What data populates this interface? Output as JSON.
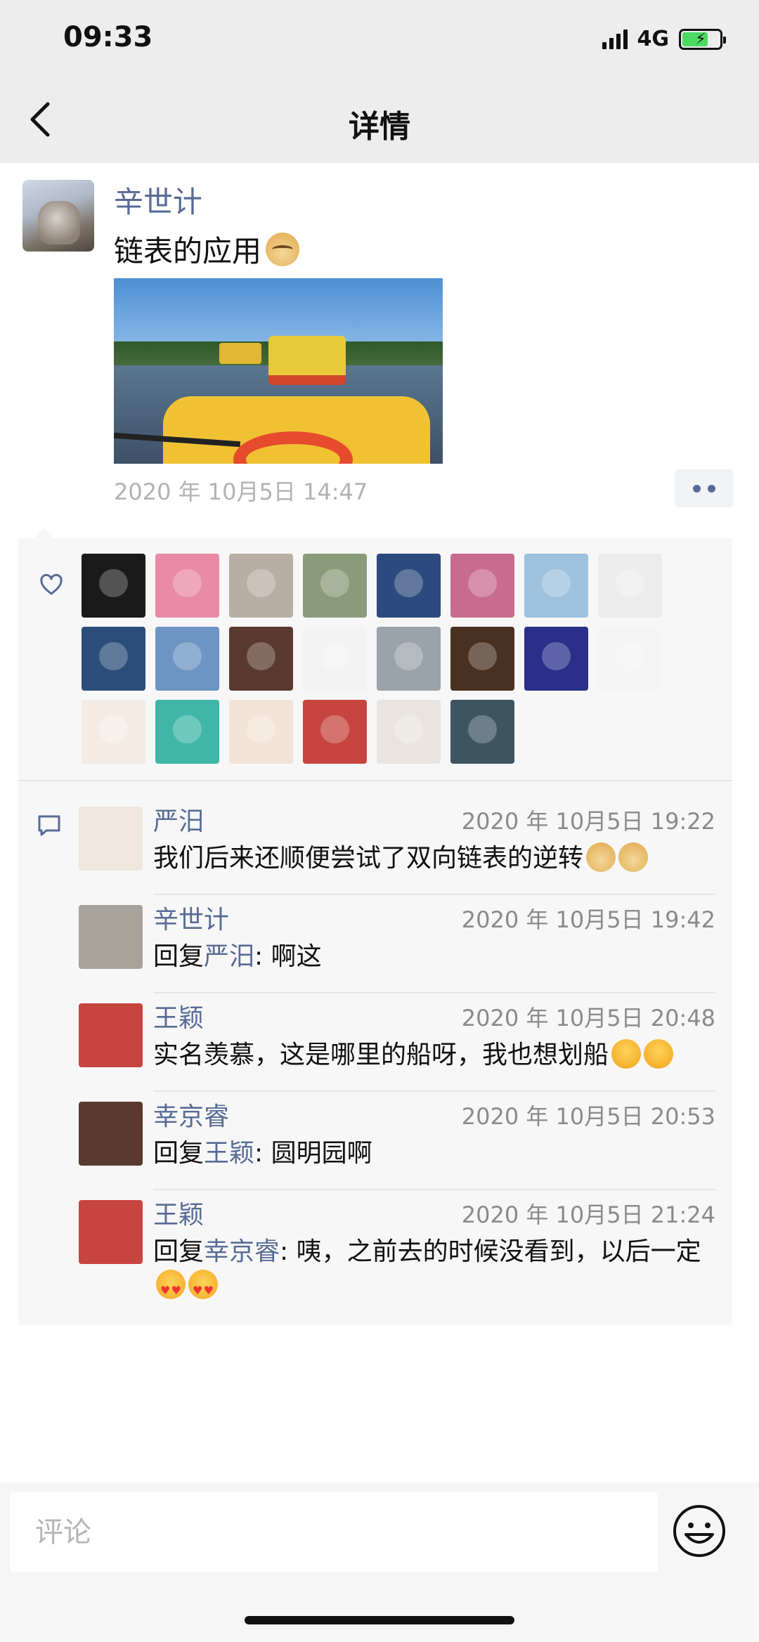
{
  "status_bar": {
    "time": "09:33",
    "network": "4G"
  },
  "nav": {
    "title": "详情"
  },
  "post": {
    "author": "辛世计",
    "text": "链表的应用",
    "timestamp": "2020 年 10月5日 14:47"
  },
  "likes": {
    "avatars": [
      {
        "name": "like-avatar-1",
        "color": "#1a1a1a"
      },
      {
        "name": "like-avatar-2",
        "color": "#e98aa6"
      },
      {
        "name": "like-avatar-3",
        "color": "#b8aea4"
      },
      {
        "name": "like-avatar-4",
        "color": "#8a9b7a"
      },
      {
        "name": "like-avatar-5",
        "color": "#2c4a7e"
      },
      {
        "name": "like-avatar-6",
        "color": "#c86b8f"
      },
      {
        "name": "like-avatar-7",
        "color": "#9ec2de"
      },
      {
        "name": "like-avatar-8",
        "color": "#ececec"
      },
      {
        "name": "like-avatar-9",
        "color": "#2b4d7a"
      },
      {
        "name": "like-avatar-10",
        "color": "#6d95c4"
      },
      {
        "name": "like-avatar-11",
        "color": "#5a3a2e"
      },
      {
        "name": "like-avatar-12",
        "color": "#f3f3f3"
      },
      {
        "name": "like-avatar-13",
        "color": "#9aa3ab"
      },
      {
        "name": "like-avatar-14",
        "color": "#4a3020"
      },
      {
        "name": "like-avatar-15",
        "color": "#2a2f8a"
      },
      {
        "name": "like-avatar-16",
        "color": "#f5f5f5"
      },
      {
        "name": "like-avatar-17",
        "color": "#f4ece4"
      },
      {
        "name": "like-avatar-18",
        "color": "#3fb6a8"
      },
      {
        "name": "like-avatar-19",
        "color": "#f1e3d6"
      },
      {
        "name": "like-avatar-20",
        "color": "#c7453f"
      },
      {
        "name": "like-avatar-21",
        "color": "#e9e4df"
      },
      {
        "name": "like-avatar-22",
        "color": "#3c5561"
      }
    ]
  },
  "comments": [
    {
      "name": "严汨",
      "time": "2020 年 10月5日 19:22",
      "text": "我们后来还顺便尝试了双向链表的逆转",
      "emoji": "dog",
      "emoji_count": 2,
      "avatar_color": "#efe6de"
    },
    {
      "name": "辛世计",
      "time": "2020 年 10月5日 19:42",
      "reply_prefix": "回复",
      "reply_to": "严汨",
      "text": ": 啊这",
      "avatar_color": "#a7a39b"
    },
    {
      "name": "王颖",
      "time": "2020 年 10月5日 20:48",
      "text": "实名羡慕，这是哪里的船呀，我也想划船",
      "emoji": "hug",
      "emoji_count": 2,
      "avatar_color": "#c7453f"
    },
    {
      "name": "幸京睿",
      "time": "2020 年 10月5日 20:53",
      "reply_prefix": "回复",
      "reply_to": "王颖",
      "text": ": 圆明园啊",
      "avatar_color": "#5a3a2e"
    },
    {
      "name": "王颖",
      "time": "2020 年 10月5日 21:24",
      "reply_prefix": "回复",
      "reply_to": "幸京睿",
      "text": ": 咦，之前去的时候没看到，以后一定",
      "emoji": "love",
      "emoji_count": 2,
      "avatar_color": "#c7453f"
    }
  ],
  "input": {
    "placeholder": "评论"
  },
  "colors": {
    "link": "#576b95",
    "panel": "#f7f7f7"
  }
}
